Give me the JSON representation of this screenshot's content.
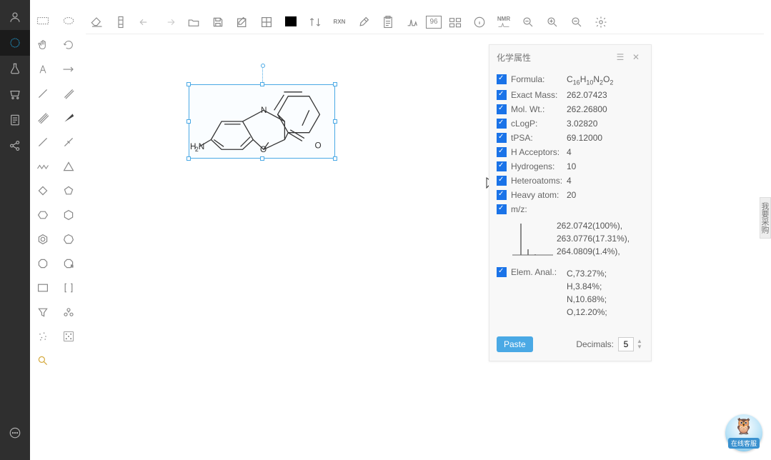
{
  "nav": {
    "items": [
      "user",
      "hex",
      "flask",
      "cart",
      "doc",
      "share"
    ],
    "bottom": "chat"
  },
  "top_toolbar": {
    "items": [
      "erase",
      "column",
      "undo",
      "redo",
      "open",
      "save",
      "edit",
      "grid",
      "color",
      "swap",
      "brush",
      "clipboard",
      "spectrum",
      "number",
      "barcode",
      "info",
      "nmr",
      "find",
      "zoom-in",
      "zoom-out",
      "settings"
    ],
    "num_label": "96",
    "rxn_label": "RXN",
    "nmr_label": "NMR"
  },
  "palette": {
    "tools": [
      "select-rect",
      "select-lasso",
      "hand",
      "rotate",
      "atom",
      "arrow",
      "bond1",
      "bond2",
      "bond3",
      "wedge",
      "bond4",
      "erase-bond",
      "chain",
      "angle",
      "wave",
      "triangle",
      "pentagon-open",
      "pentagon",
      "hexagon",
      "hexagon2",
      "benzene",
      "hexagon3",
      "cyclohexane",
      "cyclohexane2",
      "box",
      "bracket",
      "funnel",
      "group",
      "dots1",
      "dots2",
      "highlight"
    ]
  },
  "molecule": {
    "nh2_label": "H₂N",
    "n_label": "N",
    "o_label": "O",
    "o2_label": "O"
  },
  "props": {
    "title": "化学属性",
    "rows": [
      {
        "label": "Formula:",
        "value_html": "C<sub class='formula-sub'>16</sub>H<sub class='formula-sub'>10</sub>N<sub class='formula-sub'>2</sub>O<sub class='formula-sub'>2</sub>"
      },
      {
        "label": "Exact Mass:",
        "value": "262.07423"
      },
      {
        "label": "Mol. Wt.:",
        "value": "262.26800"
      },
      {
        "label": "cLogP:",
        "value": "3.02820"
      },
      {
        "label": "tPSA:",
        "value": "69.12000"
      },
      {
        "label": "H Acceptors:",
        "value": "4"
      },
      {
        "label": "Hydrogens:",
        "value": "10"
      },
      {
        "label": "Heteroatoms:",
        "value": "4"
      },
      {
        "label": "Heavy atom:",
        "value": "20"
      },
      {
        "label": "m/z:",
        "value": ""
      },
      {
        "label": "Elem. Anal.:",
        "value": "C,73.27%; H,3.84%; N,10.68%; O,12.20%;"
      }
    ],
    "mz_lines": "262.0742(100%), 263.0776(17.31%), 264.0809(1.4%),",
    "paste": "Paste",
    "decimals_label": "Decimals:",
    "decimals_value": "5"
  },
  "right_tab": "我要采购",
  "avatar_tag": "在线客服"
}
